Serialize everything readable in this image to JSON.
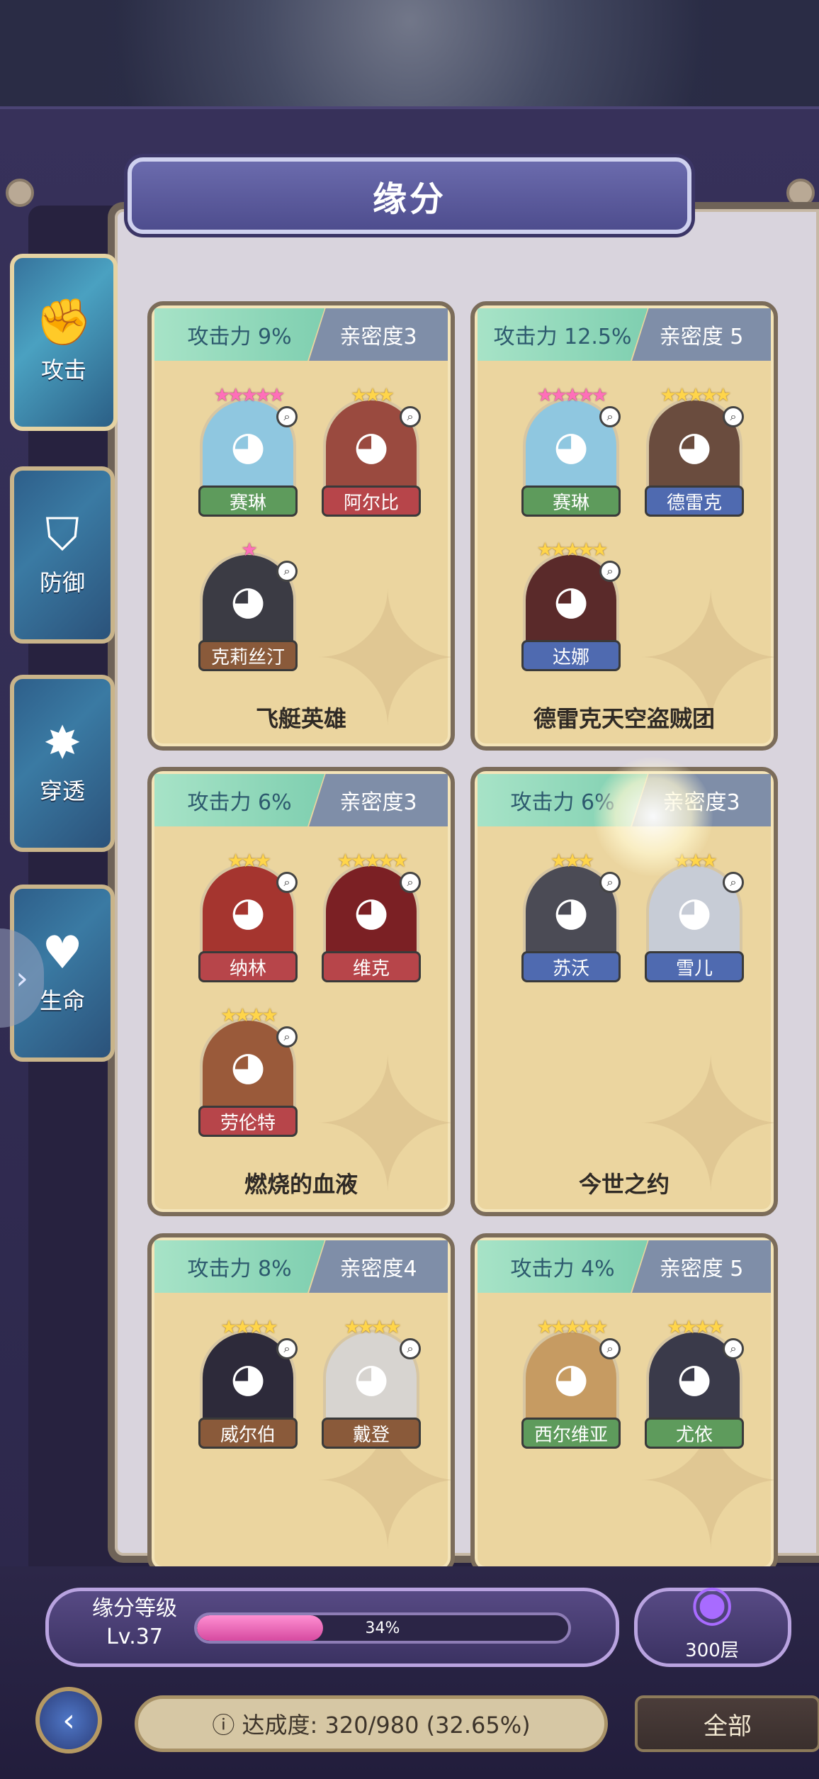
{
  "header": {
    "title": "缘分"
  },
  "sidebar": {
    "tabs": [
      {
        "label": "攻击",
        "icon": "fist-icon",
        "active": true
      },
      {
        "label": "防御",
        "icon": "shield-icon",
        "active": false
      },
      {
        "label": "穿透",
        "icon": "burst-icon",
        "active": false
      },
      {
        "label": "生命",
        "icon": "heart-icon",
        "active": false
      }
    ]
  },
  "cards": [
    {
      "atk": "攻击力 9%",
      "aff": "亲密度3",
      "name": "飞艇英雄",
      "heroes": [
        {
          "name": "赛琳",
          "color": "green",
          "stars": "★★★★★",
          "star_color": "pink",
          "bg": "#8fc7e0",
          "glyph": "◕"
        },
        {
          "name": "阿尔比",
          "color": "red",
          "stars": "★★★",
          "star_color": "gold",
          "bg": "#9a4a3f",
          "glyph": "◕"
        },
        {
          "name": "克莉丝汀",
          "color": "brown",
          "stars": "★",
          "star_color": "pink",
          "bg": "#3b3b44",
          "glyph": "◕"
        }
      ]
    },
    {
      "atk": "攻击力 12.5%",
      "aff": "亲密度 5",
      "name": "德雷克天空盗贼团",
      "heroes": [
        {
          "name": "赛琳",
          "color": "green",
          "stars": "★★★★★",
          "star_color": "pink",
          "bg": "#8fc7e0",
          "glyph": "◕"
        },
        {
          "name": "德雷克",
          "color": "blue",
          "stars": "★★★★★",
          "star_color": "gold",
          "bg": "#6a4c3e",
          "glyph": "◕"
        },
        {
          "name": "达娜",
          "color": "blue",
          "stars": "★★★★★",
          "star_color": "gold",
          "bg": "#5a2a2a",
          "glyph": "◕"
        }
      ]
    },
    {
      "atk": "攻击力 6%",
      "aff": "亲密度3",
      "name": "燃烧的血液",
      "heroes": [
        {
          "name": "纳林",
          "color": "red",
          "stars": "★★★",
          "star_color": "gold",
          "bg": "#a5352f",
          "glyph": "◕"
        },
        {
          "name": "维克",
          "color": "red",
          "stars": "★★★★★",
          "star_color": "gold",
          "bg": "#7b2024",
          "glyph": "◕"
        },
        {
          "name": "劳伦特",
          "color": "red",
          "stars": "★★★★",
          "star_color": "gold",
          "bg": "#9a5a3a",
          "glyph": "◕"
        }
      ]
    },
    {
      "atk": "攻击力 6%",
      "aff": "亲密度3",
      "name": "今世之约",
      "heroes": [
        {
          "name": "苏沃",
          "color": "blue",
          "stars": "★★★",
          "star_color": "gold",
          "bg": "#4b4b55",
          "glyph": "◕"
        },
        {
          "name": "雪儿",
          "color": "blue",
          "stars": "★★★",
          "star_color": "gold",
          "bg": "#c7ccd6",
          "glyph": "◕"
        }
      ]
    },
    {
      "atk": "攻击力 8%",
      "aff": "亲密度4",
      "name": "",
      "heroes": [
        {
          "name": "威尔伯",
          "color": "brown",
          "stars": "★★★★",
          "star_color": "gold",
          "bg": "#2d2a3a",
          "glyph": "◕"
        },
        {
          "name": "戴登",
          "color": "brown",
          "stars": "★★★★",
          "star_color": "gold",
          "bg": "#d7d4d0",
          "glyph": "◕"
        }
      ]
    },
    {
      "atk": "攻击力 4%",
      "aff": "亲密度 5",
      "name": "",
      "heroes": [
        {
          "name": "西尔维亚",
          "color": "green",
          "stars": "★★★★★",
          "star_color": "gold",
          "bg": "#c69b62",
          "glyph": "◕"
        },
        {
          "name": "尤依",
          "color": "green",
          "stars": "★★★★",
          "star_color": "gold",
          "bg": "#3a3a4a",
          "glyph": "◕"
        }
      ]
    }
  ],
  "footer": {
    "level_title": "缘分等级",
    "level_value": "Lv.37",
    "progress_fraction": 0.34,
    "progress_text": "34%",
    "tower_label": "300层",
    "achievement": "ⓘ 达成度: 320/980 (32.65%)",
    "filter": "全部"
  },
  "colors": {
    "accent": "#4e4d8e",
    "card": "#ebd59f",
    "progress": "#d64aa0"
  }
}
